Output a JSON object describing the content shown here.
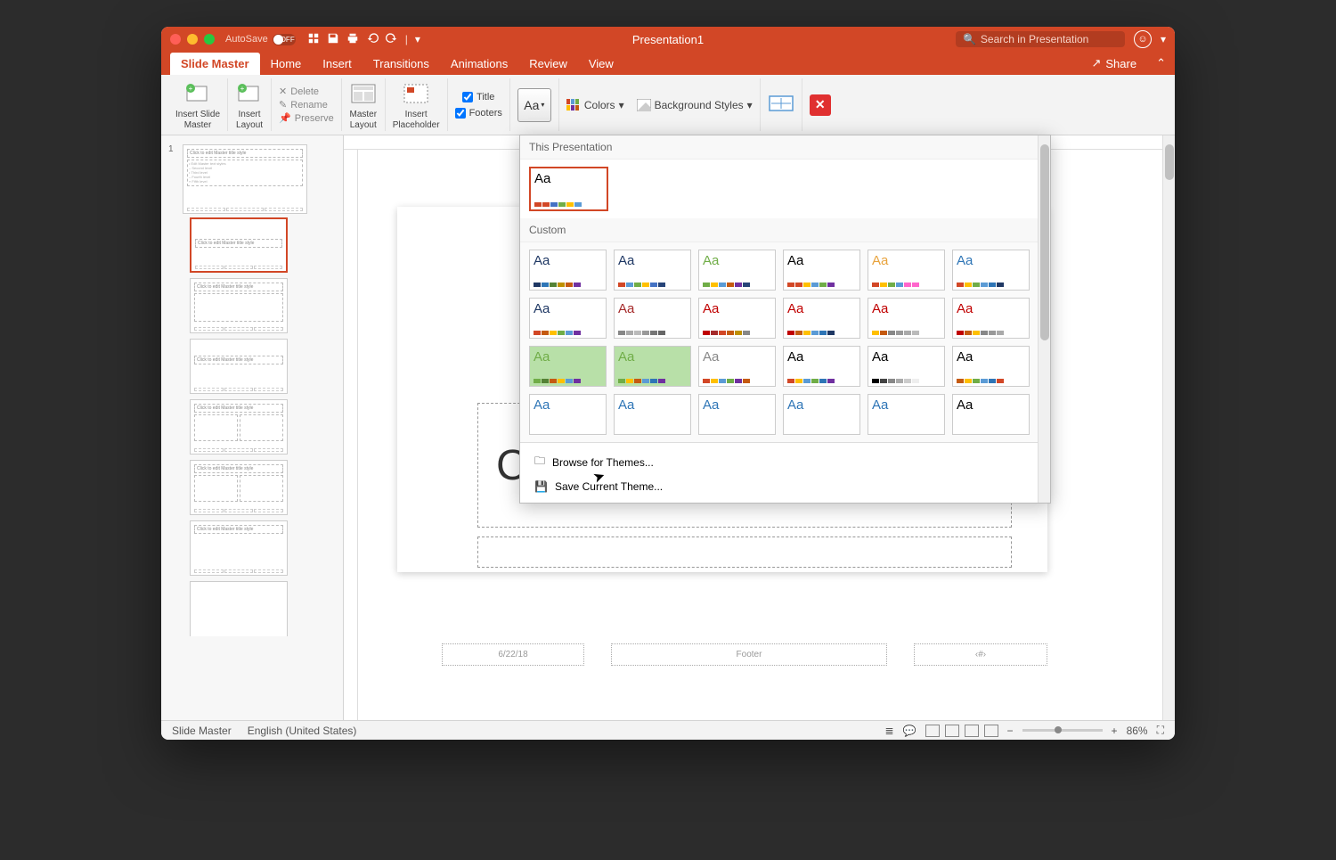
{
  "titlebar": {
    "autosave_label": "AutoSave",
    "autosave_state": "OFF",
    "doc_title": "Presentation1",
    "search_placeholder": "Search in Presentation"
  },
  "tabs": {
    "slide_master": "Slide Master",
    "home": "Home",
    "insert": "Insert",
    "transitions": "Transitions",
    "animations": "Animations",
    "review": "Review",
    "view": "View",
    "share": "Share"
  },
  "ribbon": {
    "insert_slide_master": "Insert Slide\nMaster",
    "insert_layout": "Insert\nLayout",
    "delete": "Delete",
    "rename": "Rename",
    "preserve": "Preserve",
    "master_layout": "Master\nLayout",
    "insert_placeholder": "Insert\nPlaceholder",
    "title_cb": "Title",
    "footers_cb": "Footers",
    "colors": "Colors",
    "background_styles": "Background Styles"
  },
  "themes_dropdown": {
    "section_this": "This Presentation",
    "section_custom": "Custom",
    "browse": "Browse for Themes...",
    "save": "Save Current Theme...",
    "current_theme": {
      "aa_color": "#000",
      "swatches": [
        "#d24726",
        "#d24726",
        "#4472c4",
        "#70ad47",
        "#ffc000",
        "#5b9bd5"
      ]
    },
    "custom_themes": [
      {
        "aa_color": "#1f3864",
        "swatches": [
          "#1f3864",
          "#2e75b6",
          "#548235",
          "#bf9000",
          "#c55a11",
          "#7030a0"
        ]
      },
      {
        "aa_color": "#1f3864",
        "swatches": [
          "#d24726",
          "#5b9bd5",
          "#70ad47",
          "#ffc000",
          "#4472c4",
          "#264478"
        ]
      },
      {
        "aa_color": "#70ad47",
        "swatches": [
          "#70ad47",
          "#ffc000",
          "#5b9bd5",
          "#c55a11",
          "#7030a0",
          "#264478"
        ]
      },
      {
        "aa_color": "#000",
        "swatches": [
          "#d24726",
          "#d24726",
          "#ffc000",
          "#5b9bd5",
          "#70ad47",
          "#7030a0"
        ]
      },
      {
        "aa_color": "#e8a33d",
        "swatches": [
          "#d24726",
          "#ffc000",
          "#70ad47",
          "#5b9bd5",
          "#ff66cc",
          "#ff66cc"
        ]
      },
      {
        "aa_color": "#2e75b6",
        "swatches": [
          "#d24726",
          "#ffc000",
          "#70ad47",
          "#5b9bd5",
          "#2e75b6",
          "#1f3864"
        ]
      },
      {
        "aa_color": "#1f3864",
        "swatches": [
          "#d24726",
          "#c55a11",
          "#ffc000",
          "#70ad47",
          "#5b9bd5",
          "#7030a0"
        ]
      },
      {
        "aa_color": "#a52a2a",
        "swatches": [
          "#888",
          "#aaa",
          "#bbb",
          "#999",
          "#777",
          "#666"
        ]
      },
      {
        "aa_color": "#c00000",
        "swatches": [
          "#c00000",
          "#a52a2a",
          "#d24726",
          "#c55a11",
          "#bf9000",
          "#888"
        ]
      },
      {
        "aa_color": "#c00000",
        "swatches": [
          "#c00000",
          "#c55a11",
          "#ffc000",
          "#5b9bd5",
          "#2e75b6",
          "#1f3864"
        ]
      },
      {
        "aa_color": "#c00000",
        "swatches": [
          "#ffc000",
          "#c55a11",
          "#888",
          "#999",
          "#aaa",
          "#bbb"
        ]
      },
      {
        "aa_color": "#c00000",
        "swatches": [
          "#c00000",
          "#c55a11",
          "#ffc000",
          "#888",
          "#999",
          "#aaa"
        ]
      },
      {
        "aa_color": "#70ad47",
        "swatches": [
          "#70ad47",
          "#548235",
          "#c55a11",
          "#ffc000",
          "#5b9bd5",
          "#7030a0"
        ],
        "bg": "#b8e0a8"
      },
      {
        "aa_color": "#70ad47",
        "swatches": [
          "#70ad47",
          "#ffc000",
          "#c55a11",
          "#5b9bd5",
          "#2e75b6",
          "#7030a0"
        ],
        "bg": "#b8e0a8"
      },
      {
        "aa_color": "#888",
        "swatches": [
          "#d24726",
          "#ffc000",
          "#5b9bd5",
          "#70ad47",
          "#7030a0",
          "#c55a11"
        ]
      },
      {
        "aa_color": "#000",
        "swatches": [
          "#d24726",
          "#ffc000",
          "#5b9bd5",
          "#70ad47",
          "#2e75b6",
          "#7030a0"
        ]
      },
      {
        "aa_color": "#000",
        "swatches": [
          "#000",
          "#444",
          "#888",
          "#aaa",
          "#ccc",
          "#eee"
        ]
      },
      {
        "aa_color": "#000",
        "swatches": [
          "#c55a11",
          "#ffc000",
          "#70ad47",
          "#5b9bd5",
          "#2e75b6",
          "#d24726"
        ]
      },
      {
        "aa_color": "#2e75b6",
        "swatches": []
      },
      {
        "aa_color": "#2e75b6",
        "swatches": []
      },
      {
        "aa_color": "#2e75b6",
        "swatches": []
      },
      {
        "aa_color": "#2e75b6",
        "swatches": []
      },
      {
        "aa_color": "#2e75b6",
        "swatches": []
      },
      {
        "aa_color": "#000",
        "swatches": []
      }
    ]
  },
  "thumbs": {
    "master_num": "1",
    "master_title": "Click to edit Master title style",
    "master_body": "• Edit Master text styles\n  – Second level\n    • Third level\n      – Fourth level\n        » Fifth level",
    "layout_titles": [
      "Click to edit Master title style",
      "Click to edit Master title style",
      "Click to edit Master title style",
      "Click to edit Master title style",
      "Click to edit Master title style",
      "Click to edit Master title style"
    ]
  },
  "canvas": {
    "title_partial": "C",
    "footer_date": "6/22/18",
    "footer_center": "Footer",
    "footer_num": "‹#›"
  },
  "statusbar": {
    "view": "Slide Master",
    "lang": "English (United States)",
    "zoom": "86%"
  }
}
